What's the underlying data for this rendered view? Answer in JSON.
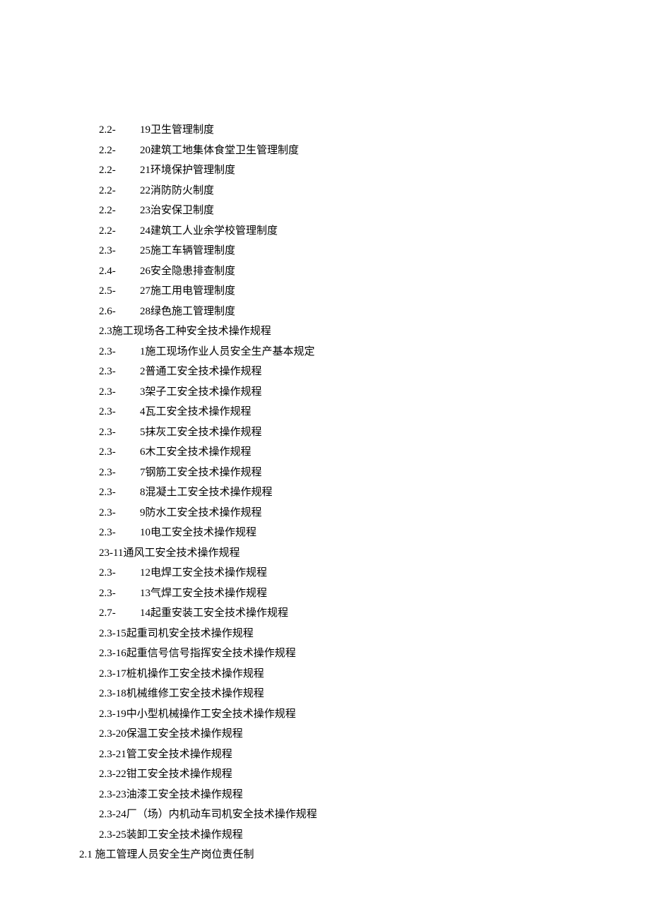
{
  "entries": [
    {
      "prefix": "2.2-",
      "num": "19",
      "title": "卫生管理制度",
      "spaced": true
    },
    {
      "prefix": "2.2-",
      "num": "20",
      "title": "建筑工地集体食堂卫生管理制度",
      "spaced": true
    },
    {
      "prefix": "2.2-",
      "num": "21",
      "title": "环境保护管理制度",
      "spaced": true
    },
    {
      "prefix": "2.2-",
      "num": "22",
      "title": "消防防火制度",
      "spaced": true
    },
    {
      "prefix": "2.2-",
      "num": "23",
      "title": "治安保卫制度",
      "spaced": true
    },
    {
      "prefix": "2.2-",
      "num": "24",
      "title": "建筑工人业余学校管理制度",
      "spaced": true
    },
    {
      "prefix": "2.3-",
      "num": "25",
      "title": "施工车辆管理制度",
      "spaced": true
    },
    {
      "prefix": "2.4-",
      "num": "26",
      "title": "安全隐患排查制度",
      "spaced": true
    },
    {
      "prefix": "2.5-",
      "num": "27",
      "title": "施工用电管理制度",
      "spaced": true
    },
    {
      "prefix": "2.6-",
      "num": "28",
      "title": "绿色施工管理制度",
      "spaced": true
    },
    {
      "prefix": "2.3",
      "num": "",
      "title": "施工现场各工种安全技术操作规程",
      "spaced": false
    },
    {
      "prefix": "2.3-",
      "num": "1",
      "title": "施工现场作业人员安全生产基本规定",
      "spaced": true
    },
    {
      "prefix": "2.3-",
      "num": "2",
      "title": "普通工安全技术操作规程",
      "spaced": true
    },
    {
      "prefix": "2.3-",
      "num": "3",
      "title": "架子工安全技术操作规程",
      "spaced": true
    },
    {
      "prefix": "2.3-",
      "num": "4",
      "title": "瓦工安全技术操作规程",
      "spaced": true
    },
    {
      "prefix": "2.3-",
      "num": "5",
      "title": "抹灰工安全技术操作规程",
      "spaced": true
    },
    {
      "prefix": "2.3-",
      "num": "6",
      "title": "木工安全技术操作规程",
      "spaced": true
    },
    {
      "prefix": "2.3-",
      "num": "7",
      "title": "钢筋工安全技术操作规程",
      "spaced": true
    },
    {
      "prefix": "2.3-",
      "num": "8",
      "title": "混凝土工安全技术操作规程",
      "spaced": true
    },
    {
      "prefix": "2.3-",
      "num": "9",
      "title": "防水工安全技术操作规程",
      "spaced": true
    },
    {
      "prefix": "2.3-",
      "num": "10",
      "title": "电工安全技术操作规程",
      "spaced": true
    },
    {
      "prefix": "23-11",
      "num": "",
      "title": "通风工安全技术操作规程",
      "spaced": false
    },
    {
      "prefix": "2.3-",
      "num": "12",
      "title": "电焊工安全技术操作规程",
      "spaced": true
    },
    {
      "prefix": "2.3-",
      "num": "13",
      "title": "气焊工安全技术操作规程",
      "spaced": true
    },
    {
      "prefix": "2.7-",
      "num": "14",
      "title": "起重安装工安全技术操作规程",
      "spaced": true
    },
    {
      "prefix": "2.3-15",
      "num": "",
      "title": "起重司机安全技术操作规程",
      "spaced": false
    },
    {
      "prefix": "2.3-16",
      "num": "",
      "title": "起重信号信号指挥安全技术操作规程",
      "spaced": false
    },
    {
      "prefix": "2.3-17",
      "num": "",
      "title": "桩机操作工安全技术操作规程",
      "spaced": false
    },
    {
      "prefix": "2.3-18",
      "num": "",
      "title": "机械维修工安全技术操作规程",
      "spaced": false
    },
    {
      "prefix": "2.3-19",
      "num": "",
      "title": "中小型机械操作工安全技术操作规程",
      "spaced": false
    },
    {
      "prefix": "2.3-20",
      "num": "",
      "title": "保温工安全技术操作规程",
      "spaced": false
    },
    {
      "prefix": "2.3-21",
      "num": "",
      "title": "管工安全技术操作规程",
      "spaced": false
    },
    {
      "prefix": "2.3-22",
      "num": "",
      "title": "钳工安全技术操作规程",
      "spaced": false
    },
    {
      "prefix": "2.3-23",
      "num": "",
      "title": "油漆工安全技术操作规程",
      "spaced": false
    },
    {
      "prefix": "2.3-24",
      "num": "",
      "title": "厂（场）内机动车司机安全技术操作规程",
      "spaced": false
    },
    {
      "prefix": "2.3-25",
      "num": "",
      "title": "装卸工安全技术操作规程",
      "spaced": false
    }
  ],
  "footer": {
    "prefix": "2.1",
    "title": "施工管理人员安全生产岗位责任制"
  }
}
